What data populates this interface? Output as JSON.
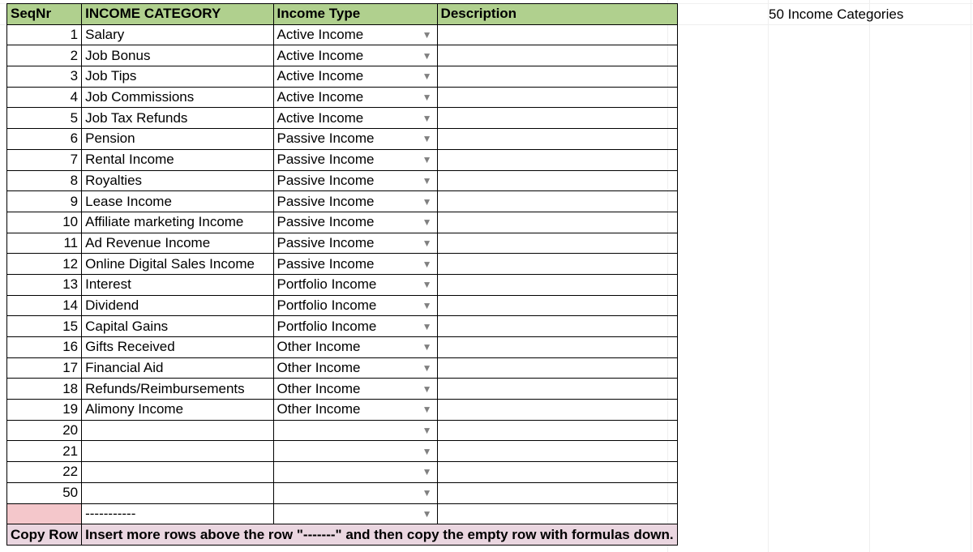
{
  "header": {
    "seq": "SeqNr",
    "category": "INCOME CATEGORY",
    "type": "Income Type",
    "description": "Description"
  },
  "side_label": "50 Income Categories",
  "separator_text": "-----------",
  "copy_row_label": "Copy Row",
  "copy_row_msg": "Insert more rows above the row \"-------\" and then copy the empty row with formulas down.",
  "rows": [
    {
      "seq": "1",
      "category": "Salary",
      "type": "Active Income",
      "description": ""
    },
    {
      "seq": "2",
      "category": "Job Bonus",
      "type": "Active Income",
      "description": ""
    },
    {
      "seq": "3",
      "category": "Job Tips",
      "type": "Active Income",
      "description": ""
    },
    {
      "seq": "4",
      "category": "Job Commissions",
      "type": "Active Income",
      "description": ""
    },
    {
      "seq": "5",
      "category": "Job Tax Refunds",
      "type": "Active Income",
      "description": ""
    },
    {
      "seq": "6",
      "category": "Pension",
      "type": "Passive Income",
      "description": ""
    },
    {
      "seq": "7",
      "category": "Rental Income",
      "type": "Passive Income",
      "description": ""
    },
    {
      "seq": "8",
      "category": "Royalties",
      "type": "Passive Income",
      "description": ""
    },
    {
      "seq": "9",
      "category": "Lease Income",
      "type": "Passive Income",
      "description": ""
    },
    {
      "seq": "10",
      "category": "Affiliate marketing Income",
      "type": "Passive Income",
      "description": ""
    },
    {
      "seq": "11",
      "category": "Ad Revenue Income",
      "type": "Passive Income",
      "description": ""
    },
    {
      "seq": "12",
      "category": "Online Digital Sales Income",
      "type": "Passive Income",
      "description": ""
    },
    {
      "seq": "13",
      "category": "Interest",
      "type": "Portfolio Income",
      "description": ""
    },
    {
      "seq": "14",
      "category": "Dividend",
      "type": "Portfolio Income",
      "description": ""
    },
    {
      "seq": "15",
      "category": "Capital Gains",
      "type": "Portfolio Income",
      "description": ""
    },
    {
      "seq": "16",
      "category": "Gifts Received",
      "type": "Other Income",
      "description": ""
    },
    {
      "seq": "17",
      "category": "Financial Aid",
      "type": "Other Income",
      "description": ""
    },
    {
      "seq": "18",
      "category": "Refunds/Reimbursements",
      "type": "Other Income",
      "description": ""
    },
    {
      "seq": "19",
      "category": "Alimony Income",
      "type": "Other Income",
      "description": ""
    },
    {
      "seq": "20",
      "category": "",
      "type": "",
      "description": ""
    },
    {
      "seq": "21",
      "category": "",
      "type": "",
      "description": ""
    },
    {
      "seq": "22",
      "category": "",
      "type": "",
      "description": ""
    },
    {
      "seq": "50",
      "category": "",
      "type": "",
      "description": ""
    }
  ]
}
